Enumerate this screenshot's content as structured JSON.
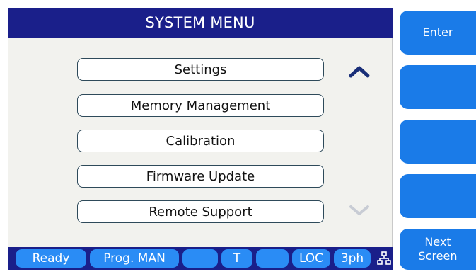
{
  "header": {
    "title": "SYSTEM MENU"
  },
  "menu": {
    "items": [
      {
        "label": "Settings"
      },
      {
        "label": "Memory Management"
      },
      {
        "label": "Calibration"
      },
      {
        "label": "Firmware Update"
      },
      {
        "label": "Remote Support"
      }
    ],
    "scroll_up_icon": "chevron-up",
    "scroll_down_icon": "chevron-down"
  },
  "softkeys": {
    "enter_label": "Enter",
    "key2_label": "",
    "key3_label": "",
    "key4_label": "",
    "next_screen_line1": "Next",
    "next_screen_line2": "Screen"
  },
  "status": {
    "ready": "Ready",
    "prog": "Prog. MAN",
    "slot3": "",
    "t": "T",
    "slot5": "",
    "loc": "LOC",
    "phase": "3ph",
    "network_icon": "network-icon"
  },
  "colors": {
    "title_bar": "#1a1f8a",
    "softkey": "#1a7be8",
    "status_pill": "#2a8cf5",
    "panel_bg": "#f2f2ee"
  }
}
